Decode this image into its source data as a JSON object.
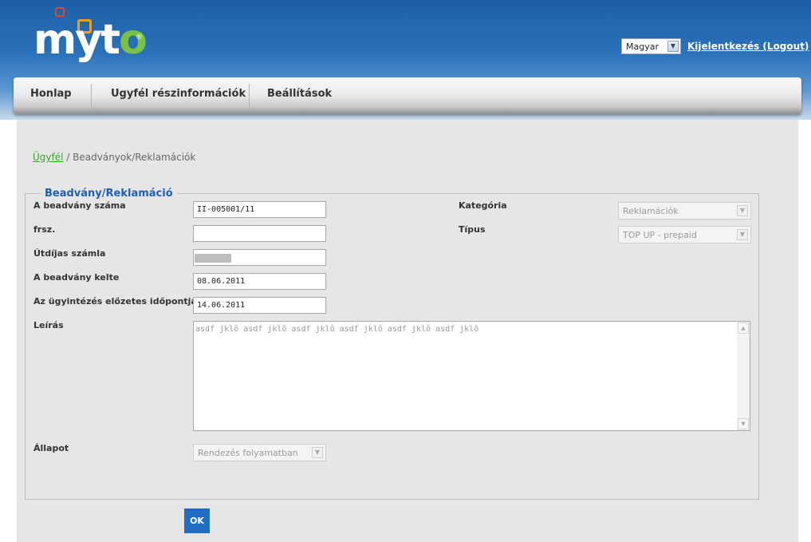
{
  "header": {
    "logo": {
      "text_main": "myt",
      "text_accent": "o",
      "reg_mark": "®"
    },
    "language_select": {
      "value": "Magyar"
    },
    "logout_label": "Kijelentkezés (Logout)"
  },
  "nav": {
    "items": [
      {
        "label": "Honlap"
      },
      {
        "label": "Ugyfél részinformációk"
      },
      {
        "label": "Beállítások"
      }
    ]
  },
  "breadcrumb": {
    "link": "Ügyfél",
    "separator": "/",
    "current": "Beadványok/Reklamációk"
  },
  "form": {
    "legend": "Beadvány/Reklamáció",
    "fields": {
      "number": {
        "label": "A beadvány száma",
        "value": "II-005001/11"
      },
      "frsz": {
        "label": "frsz.",
        "value": ""
      },
      "toll_invoice": {
        "label": "Útdíjas számla",
        "value": ""
      },
      "date": {
        "label": "A beadvány kelte",
        "value": "08.06.2011"
      },
      "deadline": {
        "label": "Az ügyintézés előzetes időpontja",
        "value": "14.06.2011"
      },
      "category": {
        "label": "Kategória",
        "value": "Reklamációk"
      },
      "type": {
        "label": "Típus",
        "value": "TOP UP - prepaid"
      },
      "description": {
        "label": "Leírás",
        "value": "asdf jklô asdf jklô asdf jklô asdf jklô asdf jklô asdf jklô"
      },
      "status": {
        "label": "Állapot",
        "value": "Rendezés folyamatban"
      }
    }
  },
  "ok_label": "OK",
  "colors": {
    "header_blue": "#2b72bb",
    "legend_blue": "#1f5fb1",
    "link_green": "#3aa52b",
    "button_blue": "#1f6ec4",
    "logo_green": "#7bc143",
    "logo_red": "#e8432e",
    "logo_orange": "#f39c2b"
  },
  "icons": [
    "chevron-down-icon",
    "scroll-up-icon",
    "scroll-down-icon"
  ]
}
